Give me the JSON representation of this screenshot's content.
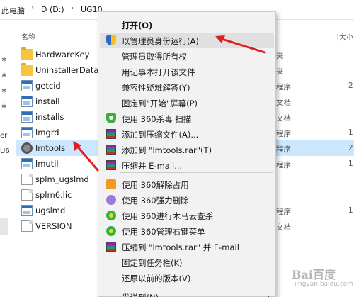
{
  "breadcrumb": {
    "items": [
      "此电脑",
      "D (D:)",
      "UG10"
    ]
  },
  "columns": {
    "name": "名称",
    "size": "大小"
  },
  "nav": {
    "fragments": [
      "er",
      "U6"
    ]
  },
  "files": [
    {
      "name": "HardwareKey",
      "icon": "folder-icon",
      "type_frag": "夹",
      "size_frag": ""
    },
    {
      "name": "UninstallerData",
      "icon": "folder-icon",
      "type_frag": "夹",
      "size_frag": ""
    },
    {
      "name": "getcid",
      "icon": "exe-icon",
      "type_frag": "程序",
      "size_frag": "2"
    },
    {
      "name": "install",
      "icon": "exe-icon",
      "type_frag": "文档",
      "size_frag": ""
    },
    {
      "name": "installs",
      "icon": "exe-icon",
      "type_frag": "文档",
      "size_frag": ""
    },
    {
      "name": "lmgrd",
      "icon": "exe-icon",
      "type_frag": "程序",
      "size_frag": "1"
    },
    {
      "name": "lmtools",
      "icon": "gear-app-icon",
      "type_frag": "程序",
      "size_frag": "2"
    },
    {
      "name": "lmutil",
      "icon": "exe-icon",
      "type_frag": "程序",
      "size_frag": "1"
    },
    {
      "name": "splm_ugslmd",
      "icon": "doc-icon",
      "type_frag": "",
      "size_frag": ""
    },
    {
      "name": "splm6.lic",
      "icon": "doc-icon",
      "type_frag": "",
      "size_frag": ""
    },
    {
      "name": "ugslmd",
      "icon": "exe-icon",
      "type_frag": "程序",
      "size_frag": "1"
    },
    {
      "name": "VERSION",
      "icon": "doc-icon",
      "type_frag": "文档",
      "size_frag": ""
    }
  ],
  "selected_file": "lmtools",
  "context_menu": {
    "items": [
      {
        "label": "打开(O)",
        "bold": true,
        "icon": ""
      },
      {
        "label": "以管理员身份运行(A)",
        "icon": "uac-shield-icon",
        "highlight": true
      },
      {
        "label": "管理员取得所有权",
        "icon": ""
      },
      {
        "label": "用记事本打开该文件",
        "icon": ""
      },
      {
        "label": "兼容性疑难解答(Y)",
        "icon": ""
      },
      {
        "label": "固定到\"开始\"屏幕(P)",
        "icon": ""
      },
      {
        "label": "使用 360杀毒 扫描",
        "icon": "360-antivirus-icon"
      },
      {
        "label": "添加到压缩文件(A)...",
        "icon": "winrar-icon"
      },
      {
        "label": "添加到 \"lmtools.rar\"(T)",
        "icon": "winrar-icon"
      },
      {
        "label": "压缩并 E-mail...",
        "icon": "winrar-icon"
      },
      {
        "label": "使用 360解除占用",
        "icon": "360-unlock-icon"
      },
      {
        "label": "使用 360强力删除",
        "icon": "360-delete-icon"
      },
      {
        "label": "使用 360进行木马云查杀",
        "icon": "360-trojan-icon"
      },
      {
        "label": "使用 360管理右键菜单",
        "icon": "360-menu-icon"
      },
      {
        "label": "压缩到 \"lmtools.rar\" 并 E-mail",
        "icon": "winrar-icon"
      },
      {
        "label": "固定到任务栏(K)",
        "icon": ""
      },
      {
        "label": "还原以前的版本(V)",
        "icon": ""
      },
      {
        "label": "发送到(N)",
        "icon": "",
        "submenu": true
      }
    ]
  },
  "watermark": {
    "text": "Bai百度",
    "sub": "jingyan.baidu.com"
  },
  "colors": {
    "selection": "#cce8ff",
    "menu_bg": "#f2f2f2",
    "menu_highlight": "#e0e0e0",
    "arrow": "#e02020"
  }
}
